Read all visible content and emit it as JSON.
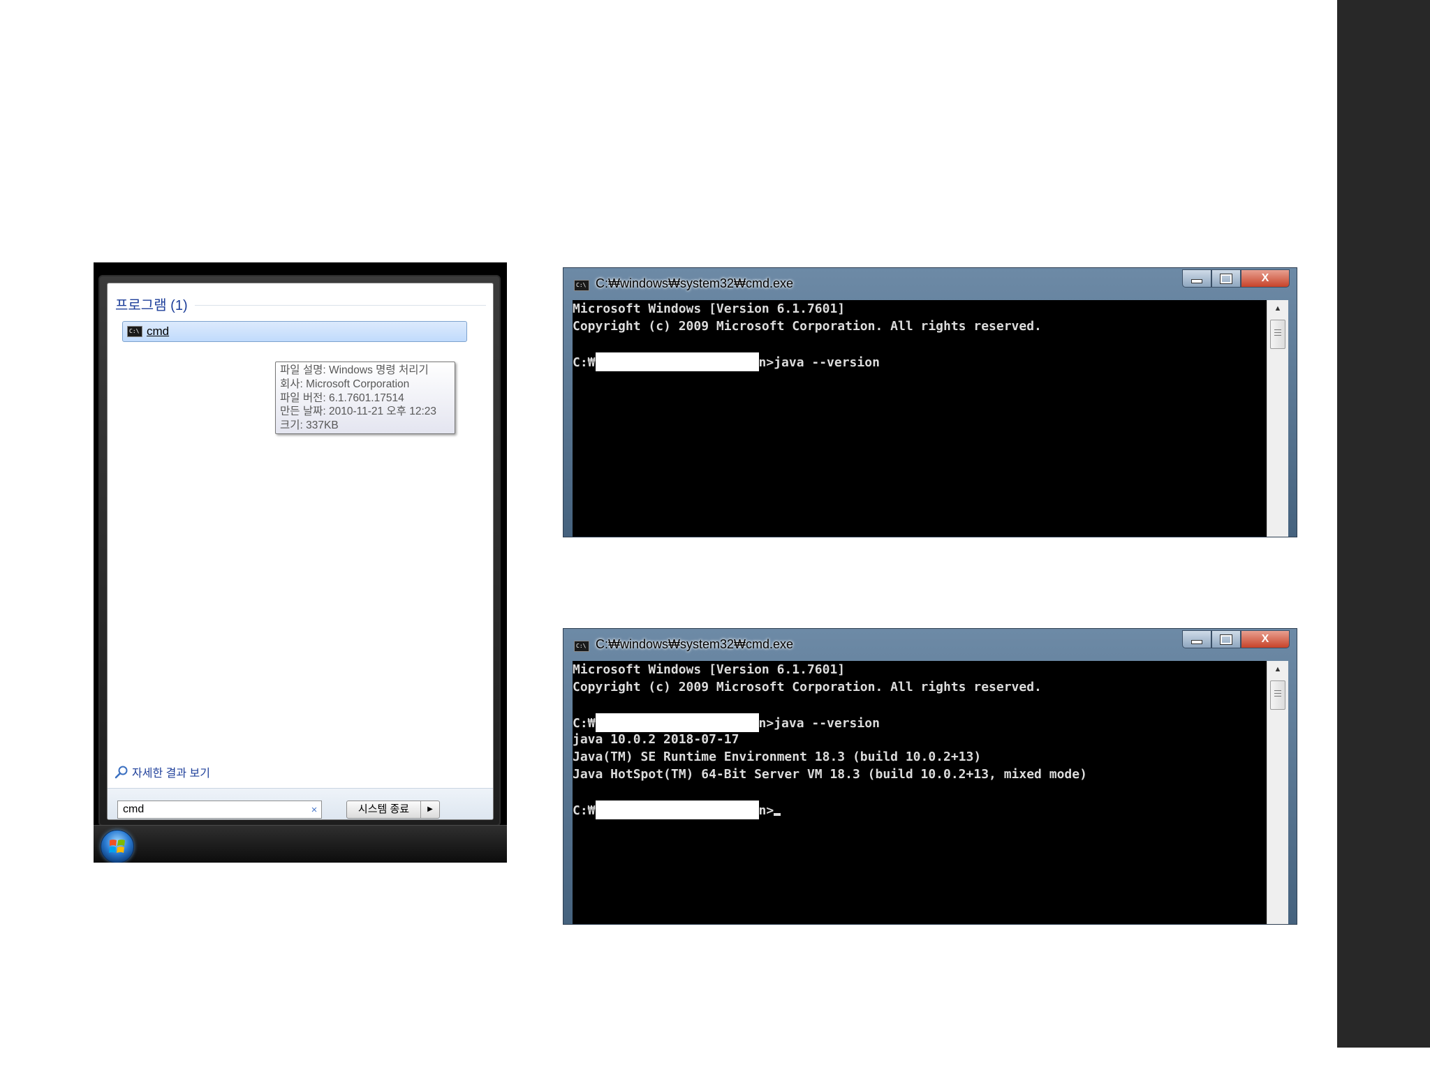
{
  "start_menu": {
    "section_title": "프로그램 (1)",
    "result_label": "cmd",
    "tooltip": [
      "파일 설명: Windows 명령 처리기",
      "회사: Microsoft Corporation",
      "파일 버전: 6.1.7601.17514",
      "만든 날짜: 2010-11-21 오후 12:23",
      "크기: 337KB"
    ],
    "see_more_label": "자세한 결과 보기",
    "search_value": "cmd",
    "clear_glyph": "×",
    "shutdown_label": "시스템 종료",
    "shutdown_arrow": "▶"
  },
  "cmd_windows": [
    {
      "title": "C:₩windows₩system32₩cmd.exe",
      "close_glyph": "X",
      "lines": [
        "Microsoft Windows [Version 6.1.7601]",
        "Copyright (c) 2009 Microsoft Corporation. All rights reserved.",
        "",
        "C:₩",
        "n>java --version"
      ]
    },
    {
      "title": "C:₩windows₩system32₩cmd.exe",
      "close_glyph": "X",
      "lines": [
        "Microsoft Windows [Version 6.1.7601]",
        "Copyright (c) 2009 Microsoft Corporation. All rights reserved.",
        "",
        "C:₩",
        "n>java --version",
        "java 10.0.2 2018-07-17",
        "Java(TM) SE Runtime Environment 18.3 (build 10.0.2+13)",
        "Java HotSpot(TM) 64-Bit Server VM 18.3 (build 10.0.2+13, mixed mode)",
        "",
        "C:₩",
        "n>"
      ]
    }
  ],
  "icons": {
    "scroll_up": "▲",
    "start_button": "windows-logo",
    "search": "magnifier"
  }
}
